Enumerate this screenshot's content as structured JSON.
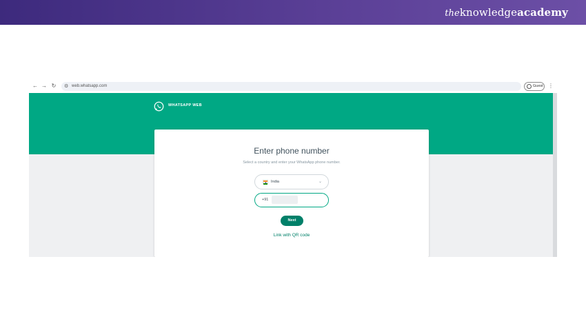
{
  "brand": {
    "prefix": "the",
    "name_part1": "knowledge",
    "name_part2": "academy"
  },
  "browser": {
    "nav_icons": [
      "back-arrow-icon",
      "forward-arrow-icon",
      "reload-icon"
    ],
    "url": "web.whatsapp.com",
    "profile_label": "Guest",
    "menu_icon": "kebab-menu-icon"
  },
  "whatsapp": {
    "header_title": "WHATSAPP WEB",
    "brand_color": "#00a884",
    "card": {
      "title": "Enter phone number",
      "subtitle": "Select a country and enter your WhatsApp phone number.",
      "country": {
        "selected": "India",
        "flag": "india-flag-icon"
      },
      "phone": {
        "dial_code": "+91",
        "value": ""
      },
      "next_label": "Next",
      "qr_link_label": "Link with QR code"
    }
  }
}
